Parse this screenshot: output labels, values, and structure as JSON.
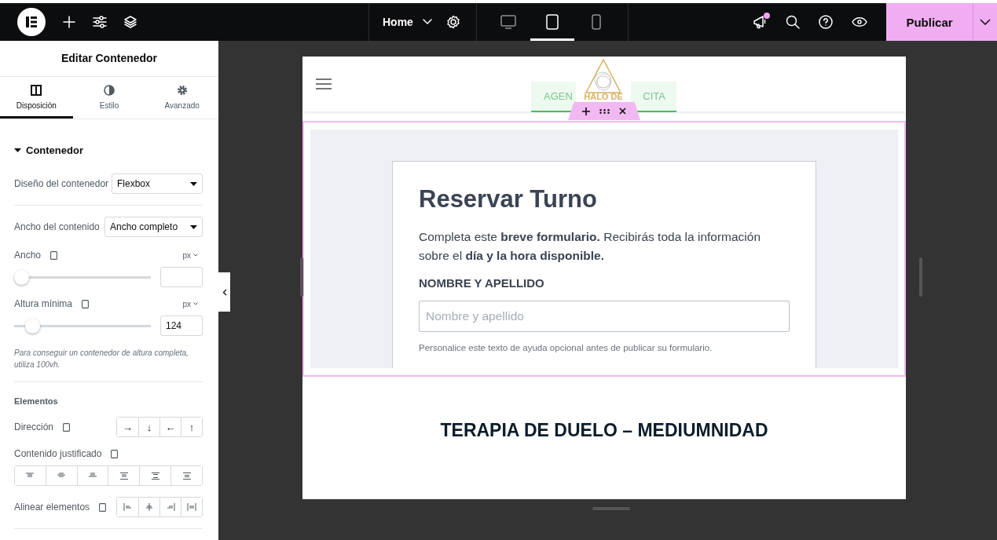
{
  "topbar": {
    "page": "Home",
    "devices": [
      {
        "kind": "desktop",
        "selected": false
      },
      {
        "kind": "tablet",
        "selected": true
      },
      {
        "kind": "mobile",
        "selected": false
      }
    ],
    "notification": true,
    "publish": "Publicar"
  },
  "panel": {
    "title": "Editar Contenedor",
    "tabs": [
      {
        "kind": "layout",
        "label": "Disposición",
        "selected": true
      },
      {
        "kind": "style",
        "label": "Estilo",
        "selected": false
      },
      {
        "kind": "advanced",
        "label": "Avanzado",
        "selected": false
      }
    ],
    "section": {
      "title": "Contenedor",
      "expanded": true
    },
    "layout_select": {
      "label": "Diseño del contenedor",
      "value": "Flexbox"
    },
    "width_select": {
      "label": "Ancho del contenido",
      "value": "Ancho completo"
    },
    "sliders": [
      {
        "label": "Ancho",
        "unit": "px",
        "level": 0
      },
      {
        "label": "Altura mínima",
        "unit": "px",
        "level": 0.09,
        "value": "124"
      }
    ],
    "hint": "Para conseguir un contenedor de altura completa, utiliza 100vh.",
    "elements_title": "Elementos",
    "direction": {
      "label": "Dirección",
      "options": [
        "→",
        "↓",
        "←",
        "↑"
      ]
    },
    "justify": {
      "label": "Contenido justificado",
      "options": [
        {
          "kind": "start"
        },
        {
          "kind": "center"
        },
        {
          "kind": "end"
        },
        {
          "kind": "space-between"
        },
        {
          "kind": "space-around"
        },
        {
          "kind": "space-evenly"
        }
      ]
    },
    "align": {
      "label": "Alinear elementos",
      "options": [
        {
          "kind": "start"
        },
        {
          "kind": "center"
        },
        {
          "kind": "end"
        },
        {
          "kind": "stretch"
        }
      ]
    }
  },
  "preview": {
    "header_button": {
      "left": "AGEN",
      "right": "CITA"
    },
    "logo": "HALO DE",
    "form": {
      "title": "Reservar Turno",
      "intro": "Completa este **breve formulario.** Recibirás toda la información sobre el **día y la hora disponible.**",
      "field_label": "NOMBRE Y APELLIDO",
      "placeholder": "Nombre y apellido",
      "help": "Personalice este texto de ayuda opcional antes de publicar su formulario."
    },
    "heading": "TERAPIA DE DUELO – MEDIUMNIDAD"
  }
}
